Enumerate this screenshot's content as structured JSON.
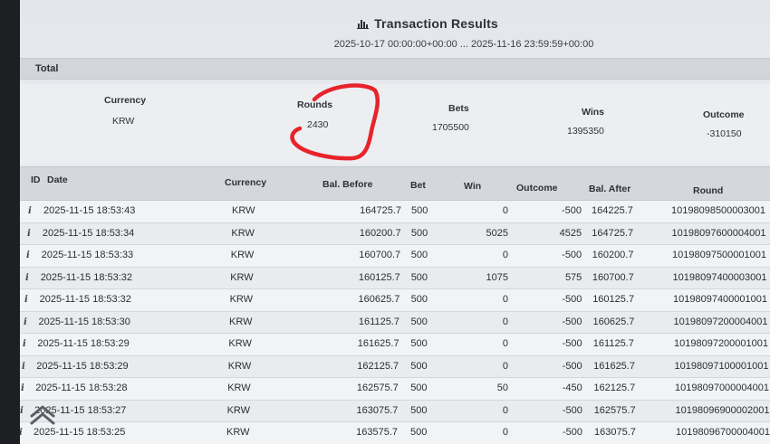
{
  "header": {
    "title": "Transaction Results",
    "title_icon": "bar-chart-icon",
    "range": "2025-10-17 00:00:00+00:00 ... 2025-11-16 23:59:59+00:00"
  },
  "total": {
    "label": "Total",
    "columns": [
      "Currency",
      "Rounds",
      "Bets",
      "Wins",
      "Outcome"
    ],
    "values": [
      "KRW",
      "2430",
      "1705500",
      "1395350",
      "-310150"
    ]
  },
  "table": {
    "columns": [
      "ID",
      "Date",
      "Currency",
      "Bal. Before",
      "Bet",
      "Win",
      "Outcome",
      "Bal. After",
      "Round"
    ],
    "rows": [
      [
        "2025-11-15 18:53:43",
        "KRW",
        "164725.7",
        "500",
        "0",
        "-500",
        "164225.7",
        "10198098500003001"
      ],
      [
        "2025-11-15 18:53:34",
        "KRW",
        "160200.7",
        "500",
        "5025",
        "4525",
        "164725.7",
        "10198097600004001"
      ],
      [
        "2025-11-15 18:53:33",
        "KRW",
        "160700.7",
        "500",
        "0",
        "-500",
        "160200.7",
        "10198097500001001"
      ],
      [
        "2025-11-15 18:53:32",
        "KRW",
        "160125.7",
        "500",
        "1075",
        "575",
        "160700.7",
        "10198097400003001"
      ],
      [
        "2025-11-15 18:53:32",
        "KRW",
        "160625.7",
        "500",
        "0",
        "-500",
        "160125.7",
        "10198097400001001"
      ],
      [
        "2025-11-15 18:53:30",
        "KRW",
        "161125.7",
        "500",
        "0",
        "-500",
        "160625.7",
        "10198097200004001"
      ],
      [
        "2025-11-15 18:53:29",
        "KRW",
        "161625.7",
        "500",
        "0",
        "-500",
        "161125.7",
        "10198097200001001"
      ],
      [
        "2025-11-15 18:53:29",
        "KRW",
        "162125.7",
        "500",
        "0",
        "-500",
        "161625.7",
        "10198097100001001"
      ],
      [
        "2025-11-15 18:53:28",
        "KRW",
        "162575.7",
        "500",
        "50",
        "-450",
        "162125.7",
        "10198097000004001"
      ],
      [
        "2025-11-15 18:53:27",
        "KRW",
        "163075.7",
        "500",
        "0",
        "-500",
        "162575.7",
        "10198096900002001"
      ],
      [
        "2025-11-15 18:53:25",
        "KRW",
        "163575.7",
        "500",
        "0",
        "-500",
        "163075.7",
        "10198096700004001"
      ]
    ]
  },
  "colors": {
    "annotation": "#e8232b",
    "header_bg": "#d4d8de",
    "text": "#2a2e33"
  },
  "icons": {
    "row_info": "info-icon",
    "scroll": "chevron-up-icon"
  }
}
